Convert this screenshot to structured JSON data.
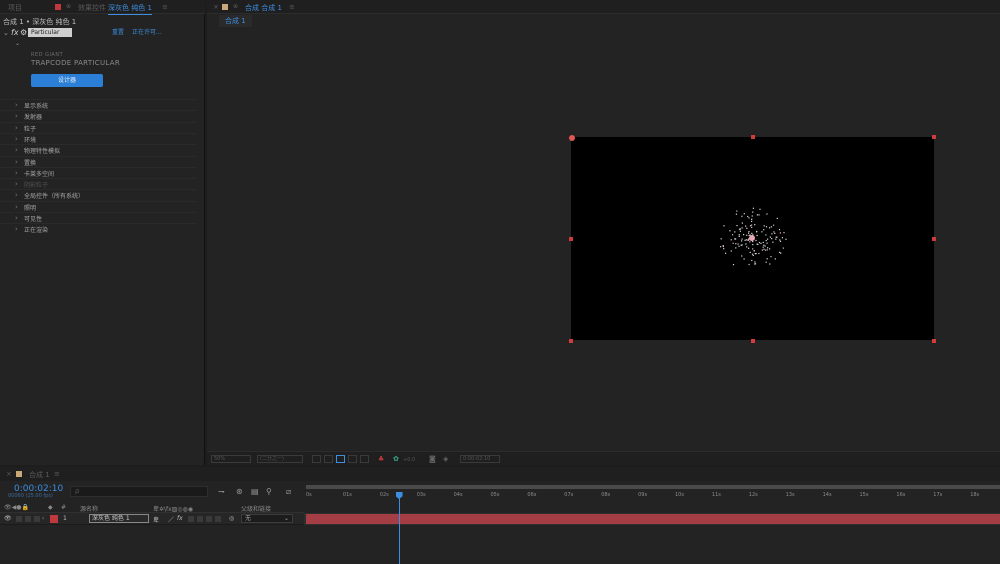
{
  "left_panel": {
    "tabs": {
      "project": "项目",
      "effect_controls": "效果控件",
      "layer": "深灰色 纯色 1"
    },
    "breadcrumb": "合成 1 • 深灰色 纯色 1",
    "effect": {
      "name": "Particular",
      "reset": "重置",
      "about": "正在许可...",
      "vendor": "RED GIANT",
      "product": "TRAPCODE PARTICULAR",
      "designer_button": "设计器"
    },
    "properties": [
      {
        "label": "显示系统"
      },
      {
        "label": "发射器"
      },
      {
        "label": "粒子"
      },
      {
        "label": "环境"
      },
      {
        "label": "物理特性模拟"
      },
      {
        "label": "置换"
      },
      {
        "label": "卡莱多空间"
      },
      {
        "label": "阴影粒子",
        "disabled": true
      },
      {
        "label": "全局控件（所有系统）"
      },
      {
        "label": "照明"
      },
      {
        "label": "可见性"
      },
      {
        "label": "正在渲染"
      }
    ]
  },
  "comp_panel": {
    "tab_title": "合成 合成 1",
    "sub_tab": "合成 1",
    "footer": {
      "zoom": "50%",
      "resolution": "(二分之一)",
      "exposure": "+0.0",
      "timecode": "0:00:02:10"
    }
  },
  "timeline": {
    "tab": "合成 1",
    "timecode": "0:00:02:10",
    "frame_info": "00060 (25.00 fps)",
    "search_placeholder": "ρ",
    "columns": {
      "num": "#",
      "source_name": "源名称",
      "parent": "父级和链接"
    },
    "layer": {
      "index": "1",
      "name": "深灰色 纯色 1",
      "parent_value": "无",
      "color": "#c0383e"
    },
    "ruler_ticks": [
      "0s",
      "01s",
      "02s",
      "03s",
      "04s",
      "05s",
      "06s",
      "07s",
      "08s",
      "09s",
      "10s",
      "11s",
      "12s",
      "13s",
      "14s",
      "15s",
      "16s",
      "17s",
      "18s"
    ],
    "playhead_seconds": 2.4
  },
  "colors": {
    "accent": "#2b7fd6",
    "handle": "#d23b3b",
    "layer_bar": "#a53d44",
    "timecode": "#3d8ee0"
  }
}
